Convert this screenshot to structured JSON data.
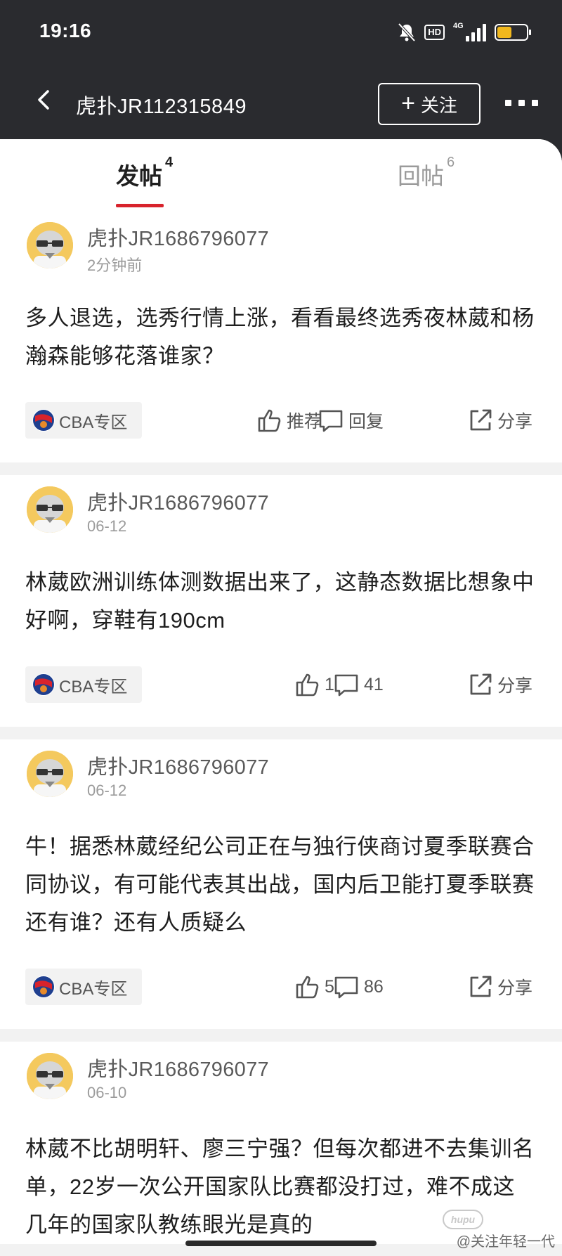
{
  "status_bar": {
    "time": "19:16",
    "hd": "HD",
    "network": "4G",
    "battery_level": 0.5
  },
  "header": {
    "title": "虎扑JR112315849",
    "follow_label": "关注"
  },
  "tabs": [
    {
      "label": "发帖",
      "count": "4"
    },
    {
      "label": "回帖",
      "count": "6"
    }
  ],
  "posts": [
    {
      "username": "虎扑JR1686796077",
      "time": "2分钟前",
      "text": "多人退选，选秀行情上涨，看看最终选秀夜林葳和杨瀚森能够花落谁家？",
      "tag": "CBA专区",
      "like": "推荐",
      "reply": "回复",
      "share": "分享"
    },
    {
      "username": "虎扑JR1686796077",
      "time": "06-12",
      "text": "林葳欧洲训练体测数据出来了，这静态数据比想象中好啊，穿鞋有190cm",
      "tag": "CBA专区",
      "like": "1",
      "reply": "41",
      "share": "分享"
    },
    {
      "username": "虎扑JR1686796077",
      "time": "06-12",
      "text": "牛！据悉林葳经纪公司正在与独行侠商讨夏季联赛合同协议，有可能代表其出战，国内后卫能打夏季联赛还有谁？还有人质疑么",
      "tag": "CBA专区",
      "like": "5",
      "reply": "86",
      "share": "分享"
    },
    {
      "username": "虎扑JR1686796077",
      "time": "06-10",
      "text": "林葳不比胡明轩、廖三宁强？但每次都进不去集训名单，22岁一次公开国家队比赛都没打过，难不成这几年的国家队教练眼光是真的"
    }
  ],
  "watermark": {
    "logo": "hupu",
    "text": "@关注年轻一代"
  },
  "colors": {
    "accent": "#d8232c",
    "header_bg": "#2a2b2f",
    "avatar_bg": "#f4c95e"
  }
}
